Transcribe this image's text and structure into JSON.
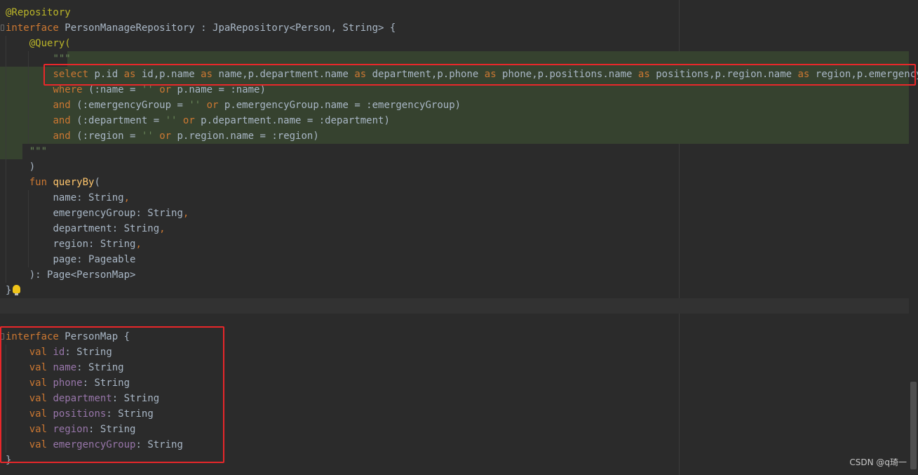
{
  "code": {
    "annotation_repository": "@Repository",
    "kw_interface": "interface",
    "repo_name": "PersonManageRepository",
    "colon_sep": " : ",
    "jpa_type": "JpaRepository<Person, String> {",
    "annotation_query": "@Query(",
    "triple_quote": "\"\"\"",
    "select_line": [
      {
        "t": "select",
        "c": "kw"
      },
      {
        "t": " p.id ",
        "c": "plain"
      },
      {
        "t": "as",
        "c": "kw"
      },
      {
        "t": " id,p.name ",
        "c": "plain"
      },
      {
        "t": "as",
        "c": "kw"
      },
      {
        "t": " name,p.department.name ",
        "c": "plain"
      },
      {
        "t": "as",
        "c": "kw"
      },
      {
        "t": " department,p.phone ",
        "c": "plain"
      },
      {
        "t": "as",
        "c": "kw"
      },
      {
        "t": " phone,p.positions.name ",
        "c": "plain"
      },
      {
        "t": "as",
        "c": "kw"
      },
      {
        "t": " positions,p.region.name ",
        "c": "plain"
      },
      {
        "t": "as",
        "c": "kw"
      },
      {
        "t": " region,p.emergencyGroup.n",
        "c": "plain"
      }
    ],
    "where_line": [
      {
        "t": "where",
        "c": "kw"
      },
      {
        "t": " (:name = ",
        "c": "plain"
      },
      {
        "t": "''",
        "c": "str"
      },
      {
        "t": " ",
        "c": "plain"
      },
      {
        "t": "or",
        "c": "kw"
      },
      {
        "t": " p.name = :name)",
        "c": "plain"
      }
    ],
    "and_emergency_line": [
      {
        "t": "and",
        "c": "kw"
      },
      {
        "t": " (:emergencyGroup = ",
        "c": "plain"
      },
      {
        "t": "''",
        "c": "str"
      },
      {
        "t": " ",
        "c": "plain"
      },
      {
        "t": "or",
        "c": "kw"
      },
      {
        "t": " p.emergencyGroup.name = :emergencyGroup)",
        "c": "plain"
      }
    ],
    "and_department_line": [
      {
        "t": "and",
        "c": "kw"
      },
      {
        "t": " (:department = ",
        "c": "plain"
      },
      {
        "t": "''",
        "c": "str"
      },
      {
        "t": " ",
        "c": "plain"
      },
      {
        "t": "or",
        "c": "kw"
      },
      {
        "t": " p.department.name = :department)",
        "c": "plain"
      }
    ],
    "and_region_line": [
      {
        "t": "and",
        "c": "kw"
      },
      {
        "t": " (:region = ",
        "c": "plain"
      },
      {
        "t": "''",
        "c": "str"
      },
      {
        "t": " ",
        "c": "plain"
      },
      {
        "t": "or",
        "c": "kw"
      },
      {
        "t": " p.region.name = :region)",
        "c": "plain"
      }
    ],
    "close_paren": ")",
    "kw_fun": "fun",
    "fn_name": "queryBy",
    "open_paren": "(",
    "params": [
      {
        "name": "name",
        "type": ": String",
        "comma": ","
      },
      {
        "name": "emergencyGroup",
        "type": ": String",
        "comma": ","
      },
      {
        "name": "department",
        "type": ": String",
        "comma": ","
      },
      {
        "name": "region",
        "type": ": String",
        "comma": ","
      },
      {
        "name": "page",
        "type": ": Pageable",
        "comma": ""
      }
    ],
    "return_type": "): Page<PersonMap>",
    "close_brace": "}",
    "person_map_name": "PersonMap {",
    "kw_val": "val",
    "fields": [
      {
        "name": "id",
        "type": ": String"
      },
      {
        "name": "name",
        "type": ": String"
      },
      {
        "name": "phone",
        "type": ": String"
      },
      {
        "name": "department",
        "type": ": String"
      },
      {
        "name": "positions",
        "type": ": String"
      },
      {
        "name": "region",
        "type": ": String"
      },
      {
        "name": "emergencyGroup",
        "type": ": String"
      }
    ]
  },
  "watermark": "CSDN @q琦一",
  "colors": {
    "keyword": "#cc7832",
    "annotation": "#bbb529",
    "function": "#ffc66d",
    "property": "#9876aa",
    "string": "#6a8759",
    "text": "#a9b7c6",
    "highlight_box": "#e8272a",
    "injection_bg": "#36422f",
    "background": "#2b2b2b"
  }
}
